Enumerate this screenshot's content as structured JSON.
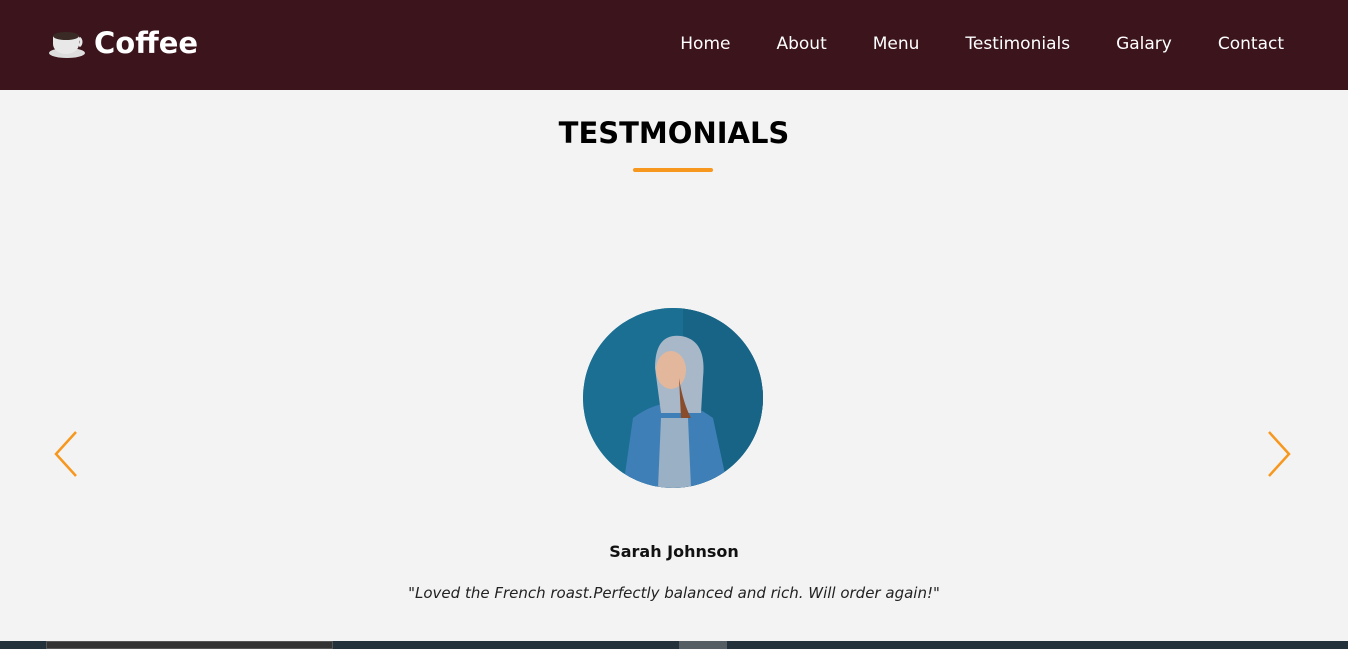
{
  "header": {
    "brand": "Coffee",
    "logo_icon": "coffee-cup-icon",
    "nav": [
      {
        "label": "Home"
      },
      {
        "label": "About"
      },
      {
        "label": "Menu"
      },
      {
        "label": "Testimonials"
      },
      {
        "label": "Galary"
      },
      {
        "label": "Contact"
      }
    ]
  },
  "section": {
    "title": "TESTMONIALS",
    "accent": "#f7971d"
  },
  "testimonial": {
    "name": "Sarah Johnson",
    "quote": "\"Loved the French roast.Perfectly balanced and rich. Will order again!\""
  },
  "colors": {
    "header_bg": "#3b141c",
    "page_bg": "#f3f3f3"
  }
}
